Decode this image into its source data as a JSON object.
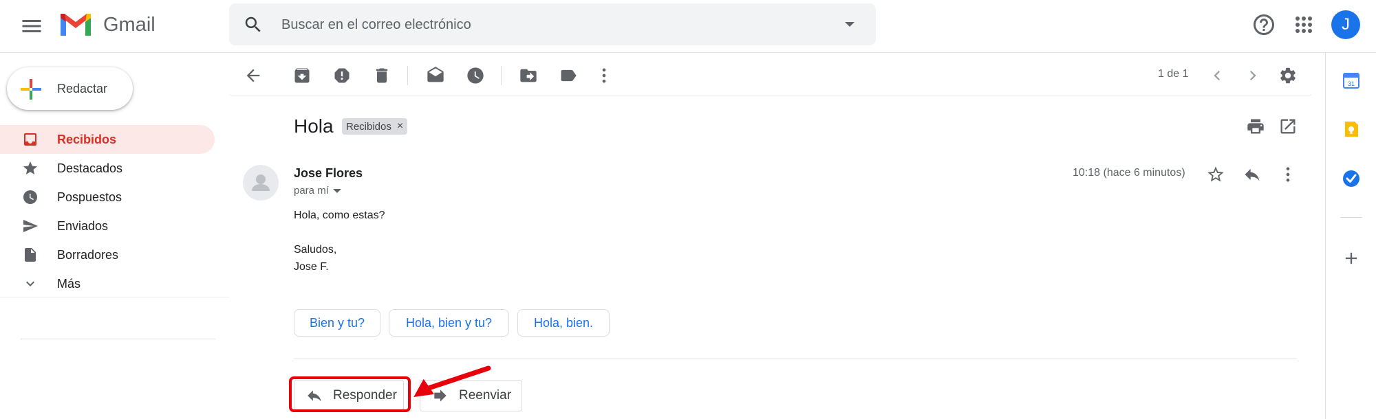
{
  "header": {
    "brand": "Gmail",
    "search_placeholder": "Buscar en el correo electrónico",
    "avatar_letter": "J"
  },
  "sidebar": {
    "compose_label": "Redactar",
    "items": [
      {
        "label": "Recibidos",
        "icon": "inbox-icon",
        "active": true
      },
      {
        "label": "Destacados",
        "icon": "star-icon"
      },
      {
        "label": "Pospuestos",
        "icon": "clock-icon"
      },
      {
        "label": "Enviados",
        "icon": "send-icon"
      },
      {
        "label": "Borradores",
        "icon": "draft-icon"
      },
      {
        "label": "Más",
        "icon": "chevron-down-icon"
      }
    ]
  },
  "toolbar": {
    "pager": "1 de 1"
  },
  "message": {
    "subject": "Hola",
    "label_chip": "Recibidos",
    "sender": "Jose Flores",
    "to": "para mí",
    "time": "10:18 (hace 6 minutos)",
    "body": [
      "Hola, como estas?",
      "Saludos,",
      "Jose F."
    ],
    "smart_replies": [
      "Bien y tu?",
      "Hola, bien y tu?",
      "Hola, bien."
    ],
    "reply_label": "Responder",
    "forward_label": "Reenviar"
  },
  "colors": {
    "accent_red": "#d93025",
    "link_blue": "#1a73e8",
    "highlight": "#e8000b",
    "avatar_bg": "#1a73e8"
  }
}
